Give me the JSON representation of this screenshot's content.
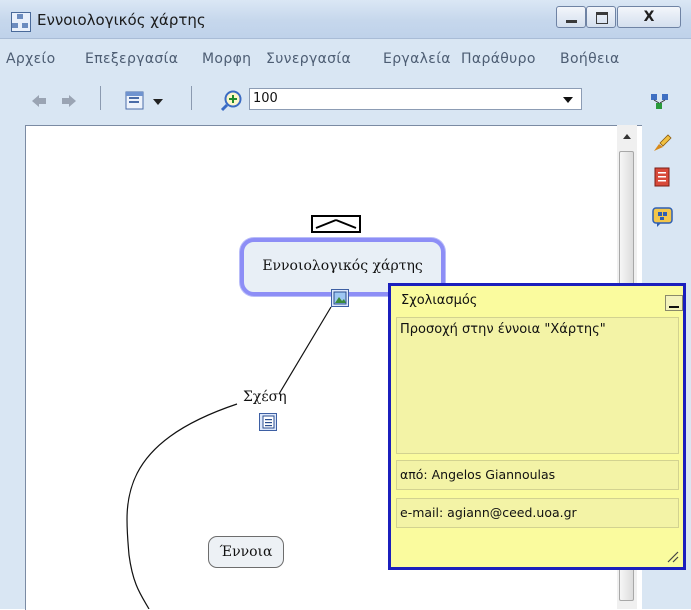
{
  "window": {
    "title": "Εννοιολογικός χάρτης",
    "close_label": "X"
  },
  "menu": {
    "items": [
      "Αρχείο",
      "Επεξεργασία",
      "Μορφη",
      "Συνεργασία",
      "Εργαλεία",
      "Παράθυρο",
      "Βοήθεια"
    ]
  },
  "toolbar": {
    "zoom_value": "100",
    "icons": [
      "back-arrow-icon",
      "forward-arrow-icon",
      "view-menu-icon",
      "zoom-in-icon"
    ]
  },
  "map": {
    "main_concept": "Εννοιολογικός χάρτης",
    "link_label": "Σχέση",
    "concept": "Έννοια"
  },
  "note": {
    "title": "Σχολιασμός",
    "body": "Προσοχή στην έννοια \"Χάρτης\"",
    "author": "από: Angelos Giannoulas",
    "email": "e-mail: agiann@ceed.uoa.gr"
  },
  "colors": {
    "selection_border": "#8d8ef6",
    "note_background": "#fafb9e",
    "note_border": "#1b1fbd",
    "window_chrome": "#d9e6f3"
  }
}
